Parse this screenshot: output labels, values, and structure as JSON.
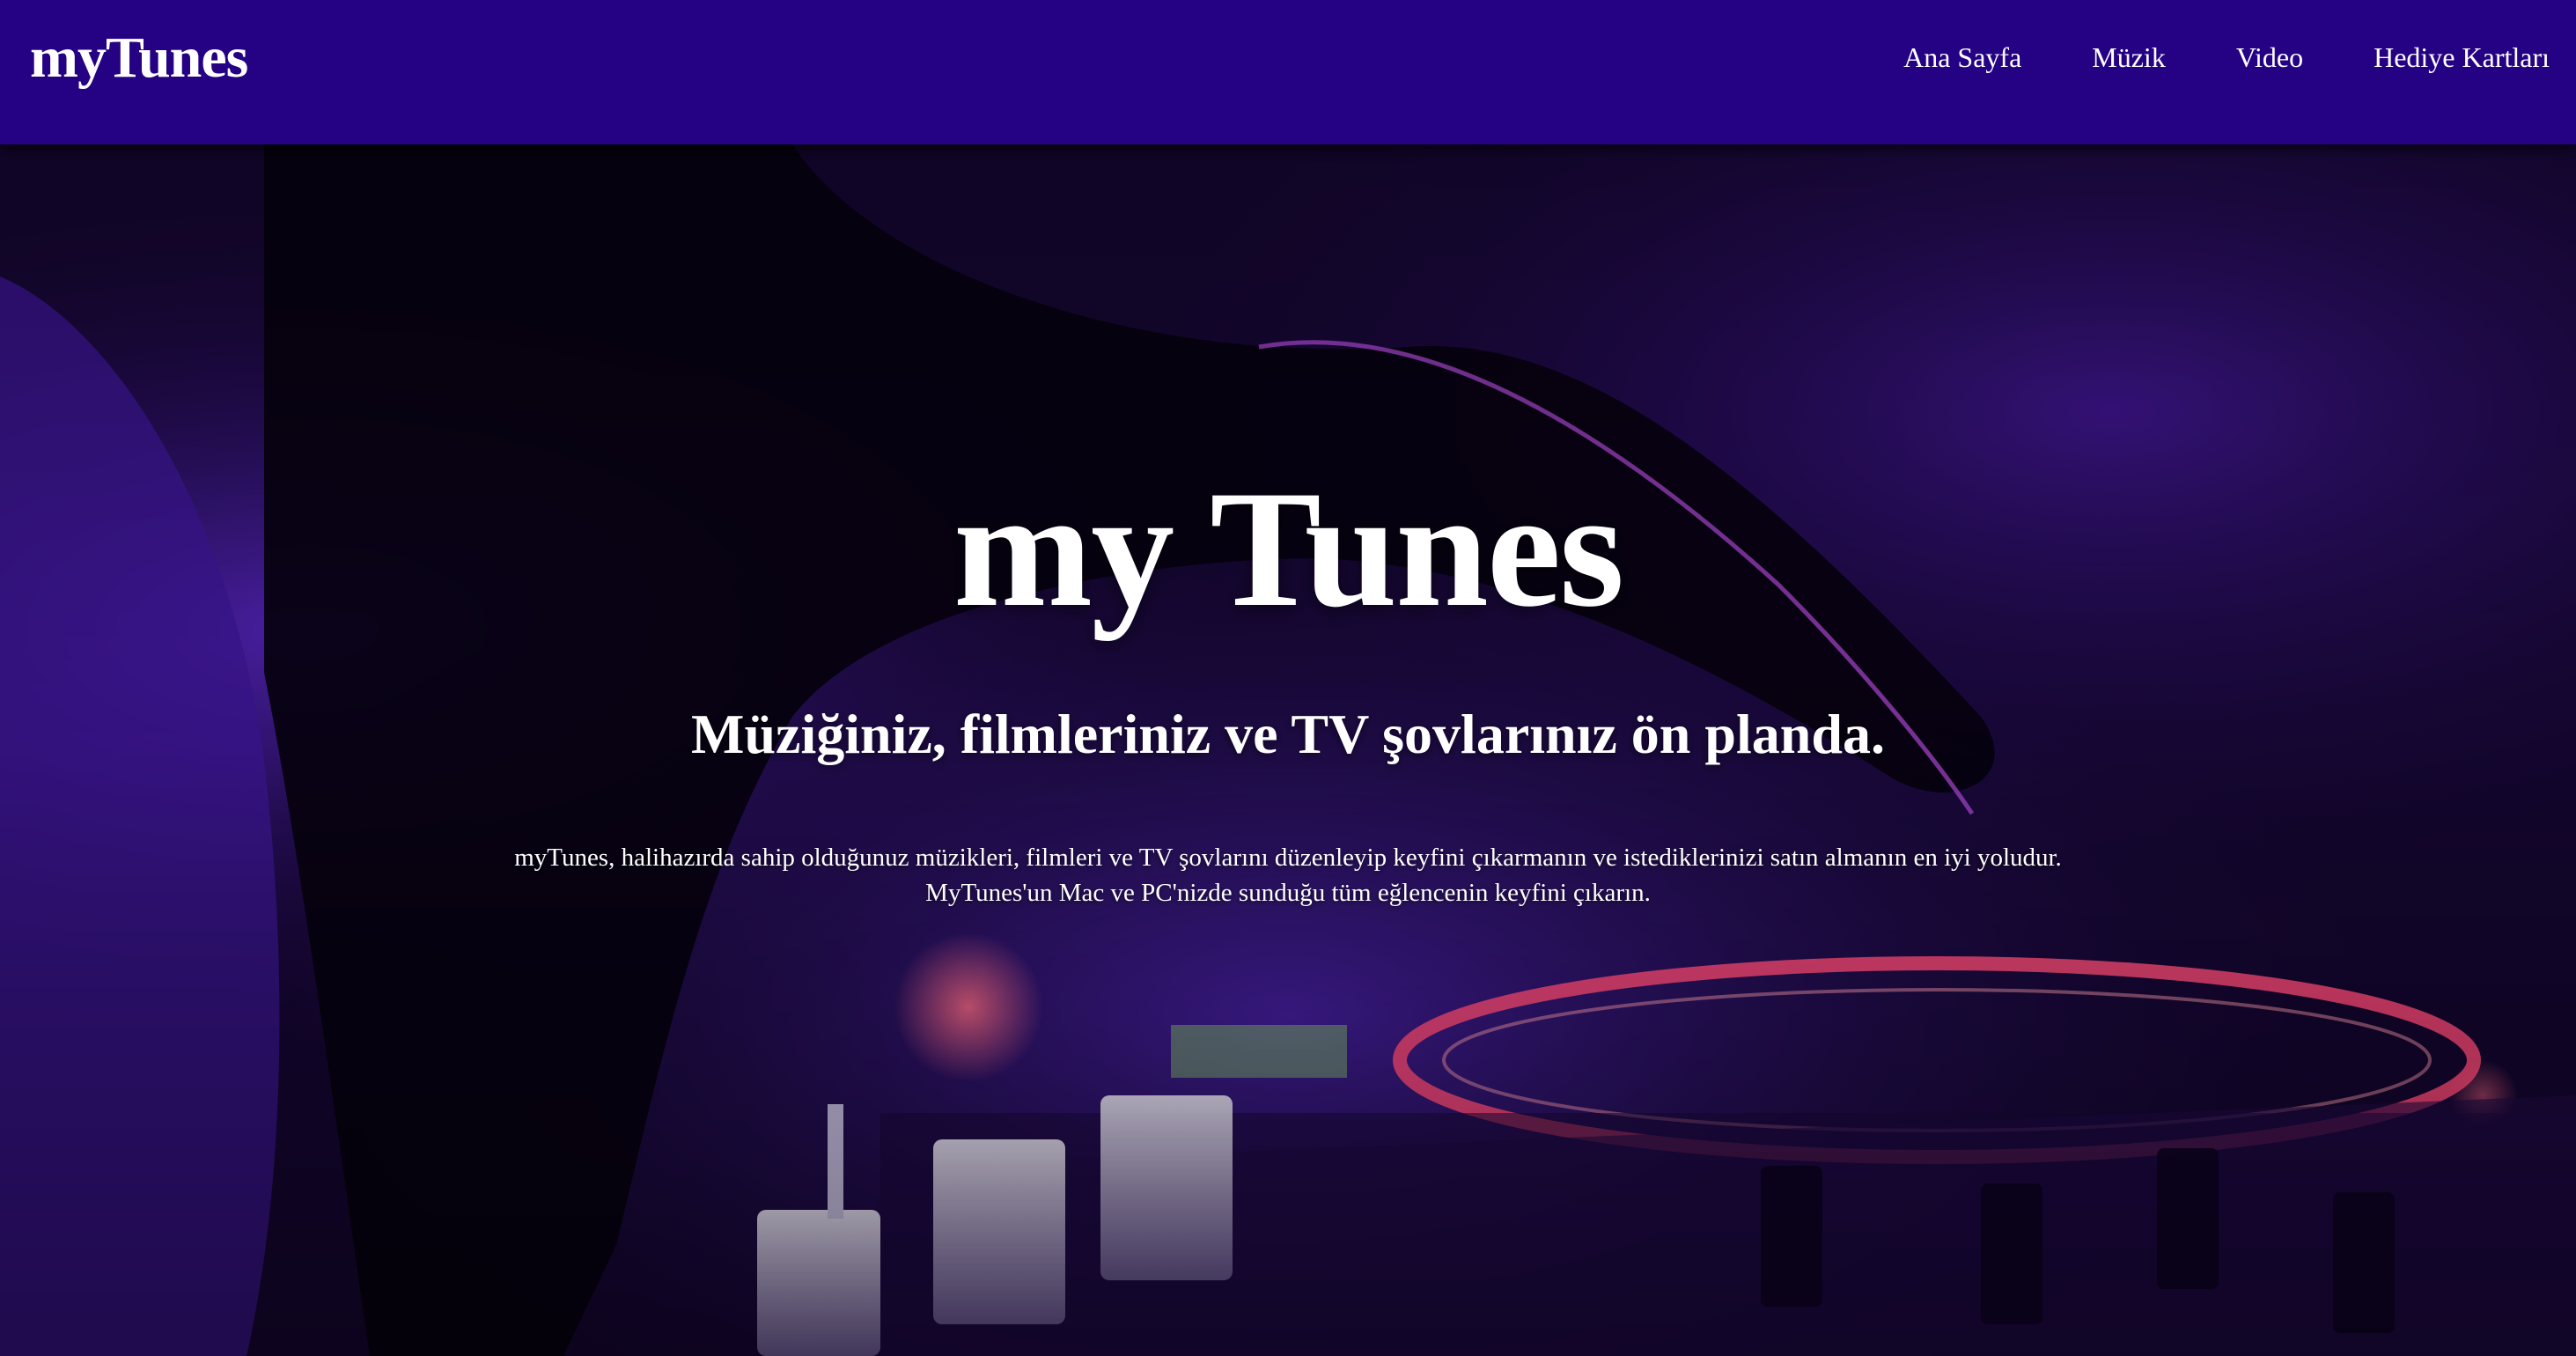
{
  "header": {
    "brand": "myTunes",
    "nav": [
      {
        "label": "Ana Sayfa"
      },
      {
        "label": "Müzik"
      },
      {
        "label": "Video"
      },
      {
        "label": "Hediye Kartları"
      }
    ]
  },
  "hero": {
    "title": "my Tunes",
    "tagline": "Müziğiniz, filmleriniz ve TV şovlarınız ön planda.",
    "description": "myTunes, halihazırda sahip olduğunuz müzikleri, filmleri ve TV şovlarını düzenleyip keyfini çıkarmanın ve istediklerinizi satın almanın en iyi yoludur. MyTunes'un Mac ve PC'nizde sunduğu tüm eğlencenin keyfini çıkarın.",
    "background": "dj-hand-turntable-mixer-purple-photo"
  },
  "colors": {
    "navbar": "#250283",
    "hero_overlay": "#3a10a8",
    "text": "#ffffff",
    "turntable_glow": "#ff4a78"
  }
}
